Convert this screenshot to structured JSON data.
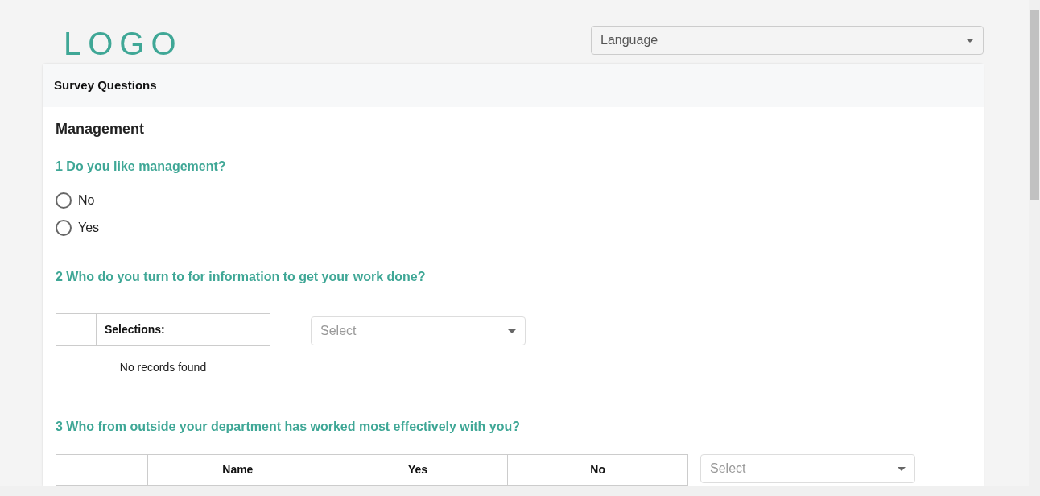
{
  "logo": "LOGO",
  "language_select": {
    "placeholder": "Language"
  },
  "card": {
    "title": "Survey Questions",
    "section": "Management",
    "questions": [
      {
        "kind": "radio",
        "title": "1 Do you like management?",
        "options": [
          {
            "label": "No",
            "selected": false
          },
          {
            "label": "Yes",
            "selected": false
          }
        ]
      },
      {
        "kind": "selection_table",
        "title": "2 Who do you turn to for information to get your work done?",
        "columns": [
          "Selections:"
        ],
        "empty_message": "No records found",
        "select": {
          "placeholder": "Select"
        }
      },
      {
        "kind": "grid_table",
        "title": "3 Who from outside your department has worked most effectively with you?",
        "columns": [
          "Name",
          "Yes",
          "No"
        ],
        "select": {
          "placeholder": "Select"
        }
      }
    ]
  }
}
